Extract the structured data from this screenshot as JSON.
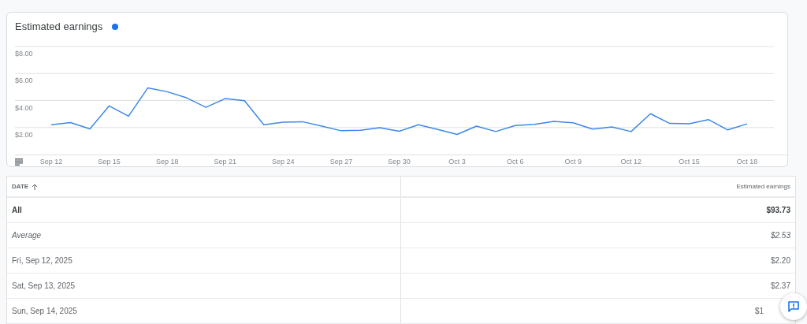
{
  "chart_card": {
    "chart_data": {
      "type": "line",
      "grid": true,
      "categories": [
        "Sep 12",
        null,
        null,
        "Sep 15",
        null,
        null,
        "Sep 18",
        null,
        null,
        "Sep 21",
        null,
        null,
        "Sep 24",
        null,
        null,
        "Sep 27",
        null,
        null,
        "Sep 30",
        null,
        null,
        "Oct 3",
        null,
        null,
        "Oct 6",
        null,
        null,
        "Oct 9",
        null,
        null,
        "Oct 12",
        null,
        null,
        "Oct 15",
        null,
        null,
        "Oct 18"
      ],
      "series": [
        {
          "name": "Estimated earnings",
          "color": "#1a73e8",
          "values": [
            2.2,
            2.37,
            1.9,
            3.6,
            2.84,
            4.94,
            4.65,
            4.2,
            3.5,
            4.14,
            3.98,
            2.2,
            2.39,
            2.43,
            2.1,
            1.76,
            1.8,
            1.98,
            1.72,
            2.2,
            1.85,
            1.49,
            2.1,
            1.7,
            2.15,
            2.24,
            2.45,
            2.35,
            1.88,
            2.04,
            1.7,
            3.02,
            2.3,
            2.28,
            2.59,
            1.82,
            2.27
          ]
        }
      ],
      "ylim": [
        0,
        8
      ],
      "yticks": [
        {
          "value": 2,
          "label": "$2.00"
        },
        {
          "value": 4,
          "label": "$4.00"
        },
        {
          "value": 6,
          "label": "$6.00"
        },
        {
          "value": 8,
          "label": "$8.00"
        }
      ]
    }
  },
  "table": {
    "columns": [
      {
        "label": "DATE",
        "sorted": true
      },
      {
        "label": "Estimated earnings",
        "sorted": false
      }
    ],
    "rows": [
      {
        "kind": "total",
        "date": "All",
        "earnings": "$93.73"
      },
      {
        "kind": "average",
        "date": "Average",
        "earnings": "$2.53"
      },
      {
        "kind": "day",
        "date": "Fri, Sep 12, 2025",
        "earnings": "$2.20"
      },
      {
        "kind": "day",
        "date": "Sat, Sep 13, 2025",
        "earnings": "$2.37"
      },
      {
        "kind": "day",
        "date": "Sun, Sep 14, 2025",
        "earnings": "$1"
      }
    ]
  }
}
